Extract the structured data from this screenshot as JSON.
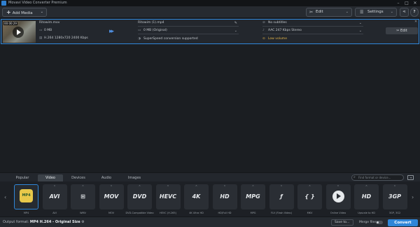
{
  "window": {
    "title": "Movavi Video Converter Premium",
    "minimize": "–",
    "maximize": "□",
    "close": "✕"
  },
  "toolbar": {
    "add_media": "Add Media",
    "edit": "Edit",
    "settings": "Settings",
    "share_icon": "share-icon",
    "help": "?"
  },
  "file": {
    "duration": "00:00:29",
    "source_name": "Ritowim.mov",
    "source_size": "0 MB",
    "source_info": "H.264 1280x720 2400 Kbps",
    "output_name": "Ritowim (1).mp4",
    "output_size": "0 MB (Original)",
    "superspeed": "SuperSpeed conversion supported",
    "subtitles": "No subtitles",
    "audio": "AAC 247 Kbps Stereo",
    "low_volume": "Low volume",
    "edit_label": "Edit"
  },
  "tabs": [
    {
      "label": "Popular",
      "active": false
    },
    {
      "label": "Video",
      "active": true
    },
    {
      "label": "Devices",
      "active": false
    },
    {
      "label": "Audio",
      "active": false
    },
    {
      "label": "Images",
      "active": false
    }
  ],
  "search": {
    "placeholder": "Find format or device..."
  },
  "formats": [
    {
      "logo": "MP4",
      "label": "MP4",
      "active": true
    },
    {
      "logo": "AVI",
      "label": "AVI",
      "active": false
    },
    {
      "logo": "⊞",
      "label": "WMV",
      "active": false
    },
    {
      "logo": "MOV",
      "label": "MOV",
      "active": false
    },
    {
      "logo": "DVD",
      "label": "DVD-Compatible Video",
      "active": false
    },
    {
      "logo": "HEVC",
      "label": "HEVC (H.265)",
      "active": false
    },
    {
      "logo": "4K",
      "label": "4K Ultra HD",
      "active": false
    },
    {
      "logo": "HD",
      "label": "HD/Full HD",
      "active": false
    },
    {
      "logo": "MPG",
      "label": "MPG",
      "active": false
    },
    {
      "logo": "ƒ",
      "label": "FLV (Flash Video)",
      "active": false
    },
    {
      "logo": "{ }",
      "label": "MKV",
      "active": false
    },
    {
      "logo": "▶",
      "label": "Online Video",
      "active": false
    },
    {
      "logo": "HD",
      "label": "Upscale to HD",
      "active": false
    },
    {
      "logo": "3GP",
      "label": "3GP, 3G2",
      "active": false
    }
  ],
  "bottom": {
    "output_label": "Output format:",
    "output_value": "MP4 H.264 - Original Size",
    "save_to": "Save to...",
    "merge_files": "Merge files:",
    "convert": "Convert"
  }
}
